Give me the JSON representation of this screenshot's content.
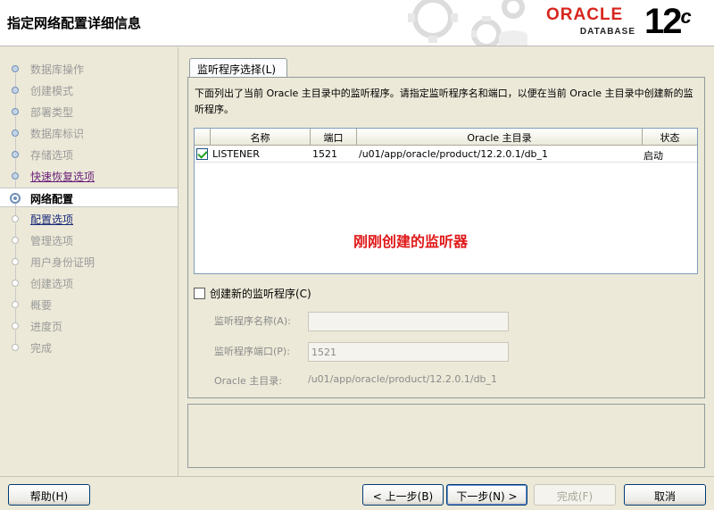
{
  "header": {
    "title": "指定网络配置详细信息",
    "brand": "ORACLE",
    "product": "DATABASE",
    "version": "12",
    "version_suffix": "c"
  },
  "sidebar": {
    "steps": [
      {
        "label": "数据库操作",
        "state": "done"
      },
      {
        "label": "创建模式",
        "state": "done"
      },
      {
        "label": "部署类型",
        "state": "done"
      },
      {
        "label": "数据库标识",
        "state": "done"
      },
      {
        "label": "存储选项",
        "state": "done"
      },
      {
        "label": "快速恢复选项",
        "state": "link-visited"
      },
      {
        "label": "网络配置",
        "state": "current"
      },
      {
        "label": "配置选项",
        "state": "link"
      },
      {
        "label": "管理选项",
        "state": "todo"
      },
      {
        "label": "用户身份证明",
        "state": "todo"
      },
      {
        "label": "创建选项",
        "state": "todo"
      },
      {
        "label": "概要",
        "state": "todo"
      },
      {
        "label": "进度页",
        "state": "todo"
      },
      {
        "label": "完成",
        "state": "todo"
      }
    ]
  },
  "tab": {
    "label": "监听程序选择(L)"
  },
  "description": "下面列出了当前 Oracle 主目录中的监听程序。请指定监听程序名和端口，以便在当前 Oracle 主目录中创建新的监听程序。",
  "table": {
    "columns": [
      "名称",
      "端口",
      "Oracle 主目录",
      "状态"
    ],
    "rows": [
      {
        "checked": true,
        "name": "LISTENER",
        "port": "1521",
        "home": "/u01/app/oracle/product/12.2.0.1/db_1",
        "status": "启动"
      }
    ]
  },
  "annotation": "刚刚创建的监听器",
  "create_new": {
    "label": "创建新的监听程序(C)",
    "checked": false
  },
  "form": {
    "name_label": "监听程序名称(A):",
    "name_value": "",
    "port_label": "监听程序端口(P):",
    "port_value": "1521",
    "home_label": "Oracle 主目录:",
    "home_value": "/u01/app/oracle/product/12.2.0.1/db_1"
  },
  "buttons": {
    "help": "帮助(H)",
    "back": "< 上一步(B)",
    "next": "下一步(N) >",
    "finish": "完成(F)",
    "cancel": "取消"
  },
  "colors": {
    "brand_red": "#d7261e",
    "annotation_red": "#e01818",
    "link": "#1b2a7a"
  }
}
